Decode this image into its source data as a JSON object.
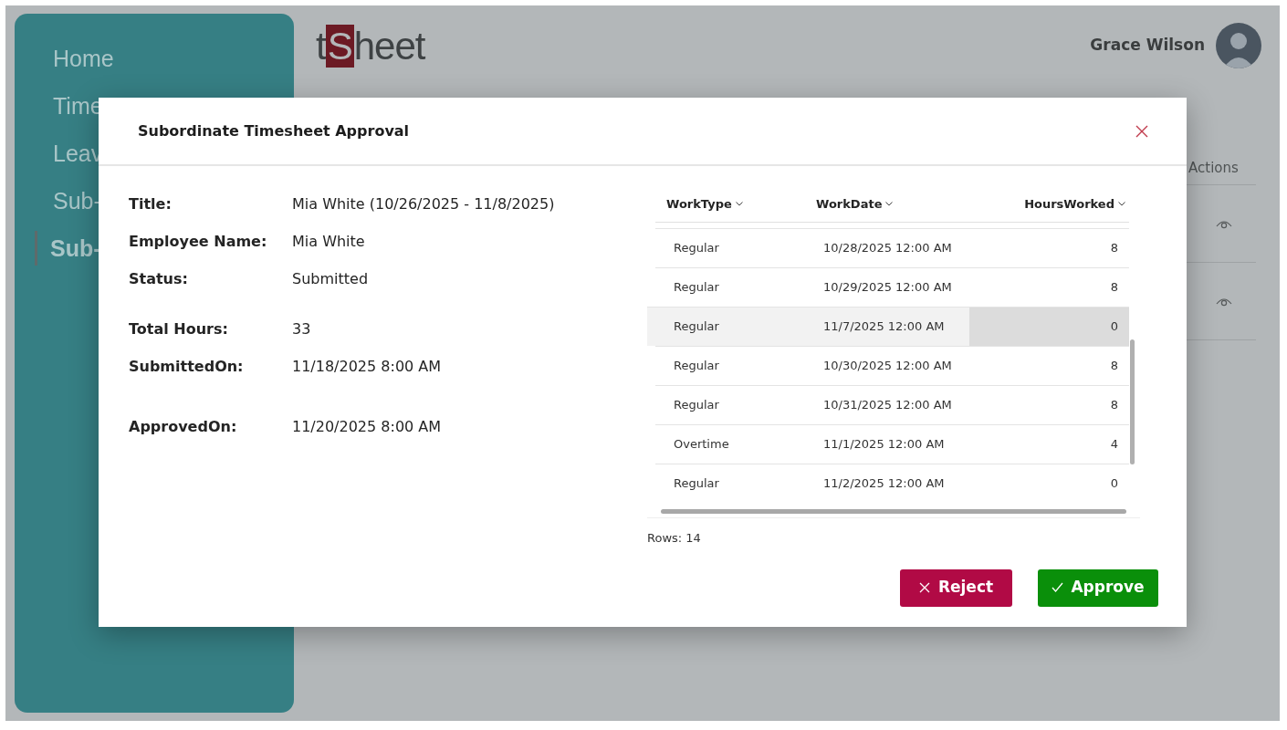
{
  "sidebar": {
    "items": [
      {
        "label": "Home",
        "selected": false
      },
      {
        "label": "Time",
        "selected": false
      },
      {
        "label": "Leav",
        "selected": false
      },
      {
        "label": "Sub-",
        "selected": false
      },
      {
        "label": "Sub-",
        "selected": true
      }
    ]
  },
  "logo": {
    "text": "tSheet"
  },
  "user": {
    "name": "Grace Wilson"
  },
  "background_table": {
    "header": "Actions"
  },
  "modal": {
    "title": "Subordinate Timesheet Approval",
    "details": [
      {
        "label": "Title:",
        "value": "Mia White (10/26/2025 - 11/8/2025)"
      },
      {
        "label": "Employee Name:",
        "value": "Mia White"
      },
      {
        "label": "Status:",
        "value": "Submitted"
      },
      {
        "label": "Total Hours:",
        "value": "33"
      },
      {
        "label": "SubmittedOn:",
        "value": "11/18/2025 8:00 AM"
      },
      {
        "label": "ApprovedOn:",
        "value": "11/20/2025 8:00 AM"
      }
    ],
    "grid": {
      "columns": [
        "WorkType",
        "WorkDate",
        "HoursWorked"
      ],
      "rows": [
        {
          "cells": [
            "Regular",
            "10/28/2025 12:00 AM",
            "8"
          ],
          "selected": false
        },
        {
          "cells": [
            "Regular",
            "10/29/2025 12:00 AM",
            "8"
          ],
          "selected": false
        },
        {
          "cells": [
            "Regular",
            "11/7/2025 12:00 AM",
            "0"
          ],
          "selected": true
        },
        {
          "cells": [
            "Regular",
            "10/30/2025 12:00 AM",
            "8"
          ],
          "selected": false
        },
        {
          "cells": [
            "Regular",
            "10/31/2025 12:00 AM",
            "8"
          ],
          "selected": false
        },
        {
          "cells": [
            "Overtime",
            "11/1/2025 12:00 AM",
            "4"
          ],
          "selected": false
        },
        {
          "cells": [
            "Regular",
            "11/2/2025 12:00 AM",
            "0"
          ],
          "selected": false
        }
      ],
      "footer": "Rows: 14"
    },
    "buttons": [
      {
        "kind": "reject",
        "label": "Reject"
      },
      {
        "kind": "approve",
        "label": "Approve"
      }
    ]
  }
}
